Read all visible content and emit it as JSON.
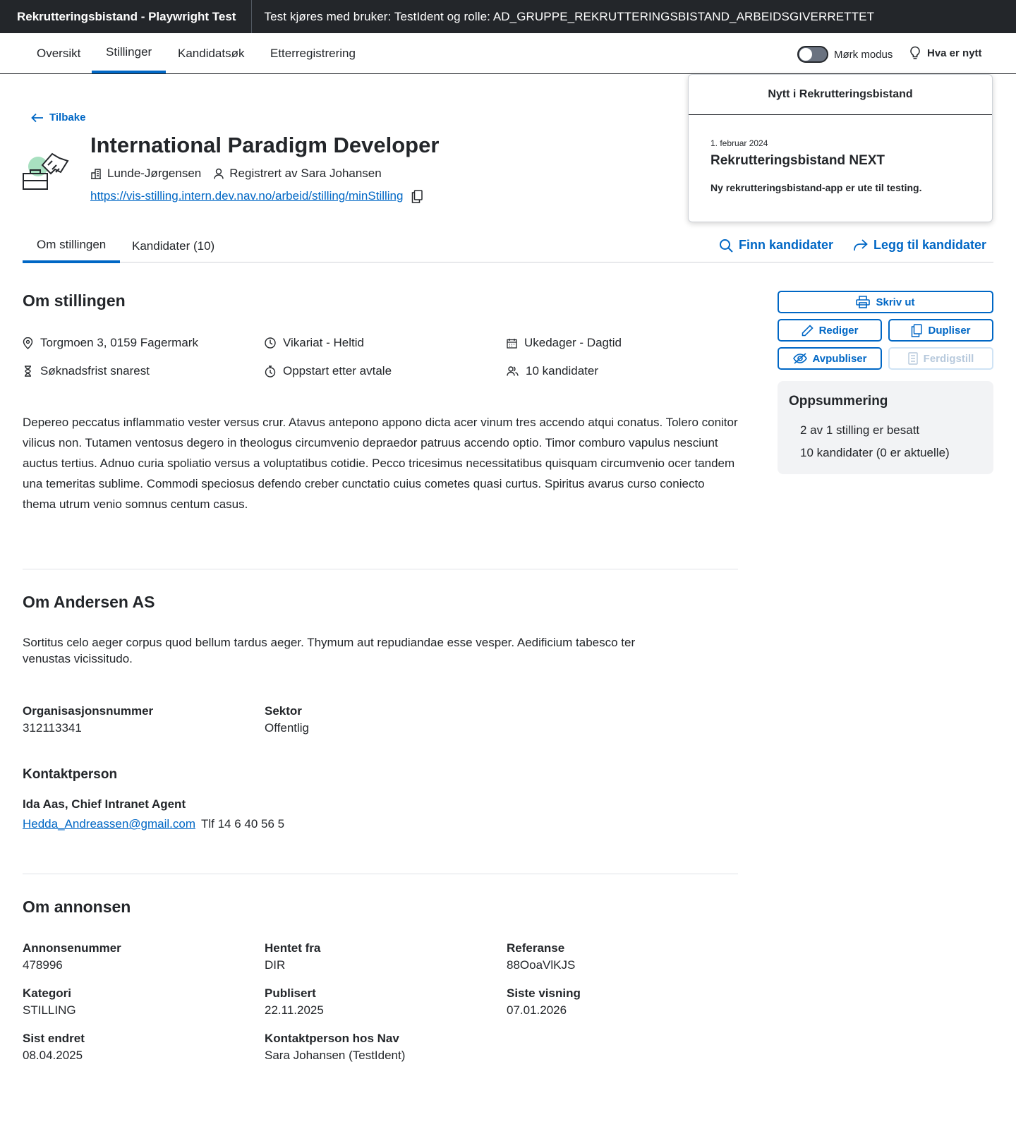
{
  "topbar": {
    "app_title": "Rekrutteringsbistand - Playwright Test",
    "test_info": "Test kjøres med bruker: TestIdent og rolle: AD_GRUPPE_REKRUTTERINGSBISTAND_ARBEIDSGIVERRETTET"
  },
  "nav": {
    "tabs": [
      "Oversikt",
      "Stillinger",
      "Kandidatsøk",
      "Etterregistrering"
    ],
    "active_tab": "Stillinger",
    "dark_mode_label": "Mørk modus",
    "news_label": "Hva er nytt"
  },
  "popover": {
    "header": "Nytt i Rekrutteringsbistand",
    "date": "1. februar 2024",
    "title": "Rekrutteringsbistand NEXT",
    "text": "Ny rekrutteringsbistand-app er ute til testing."
  },
  "header": {
    "back_label": "Tilbake",
    "job_title": "International Paradigm Developer",
    "employer": "Lunde-Jørgensen",
    "registered_by": "Registrert av Sara Johansen",
    "url": "https://vis-stilling.intern.dev.nav.no/arbeid/stilling/minStilling"
  },
  "subtabs": {
    "tabs": [
      "Om stillingen",
      "Kandidater (10)"
    ],
    "active_tab": "Om stillingen",
    "find_candidates": "Finn kandidater",
    "add_candidates": "Legg til kandidater"
  },
  "about_position": {
    "heading": "Om stillingen",
    "facts": {
      "address": "Torgmoen 3, 0159 Fagermark",
      "employment": "Vikariat - Heltid",
      "schedule": "Ukedager - Dagtid",
      "deadline": "Søknadsfrist snarest",
      "start": "Oppstart etter avtale",
      "candidates": "10 kandidater"
    },
    "description": "Depereo peccatus inflammatio vester versus crur. Atavus antepono appono dicta acer vinum tres accendo atqui conatus. Tolero conitor vilicus non. Tutamen ventosus degero in theologus circumvenio depraedor patruus accendo optio. Timor comburo vapulus nesciunt auctus tertius. Adnuo curia spoliatio versus a voluptatibus cotidie. Pecco tricesimus necessitatibus quisquam circumvenio ocer tandem una temeritas sublime. Commodi speciosus defendo creber cunctatio cuius cometes quasi curtus. Spiritus avarus curso coniecto thema utrum venio somnus centum casus."
  },
  "about_employer": {
    "heading": "Om Andersen AS",
    "description": "Sortitus celo aeger corpus quod bellum tardus aeger. Thymum aut repudiandae esse vesper. Aedificium tabesco ter venustas vicissitudo.",
    "org_number_label": "Organisasjonsnummer",
    "org_number": "312113341",
    "sector_label": "Sektor",
    "sector": "Offentlig",
    "contact_heading": "Kontaktperson",
    "contact_name": "Ida Aas, Chief Intranet Agent",
    "contact_email": "Hedda_Andreassen@gmail.com",
    "contact_phone": "Tlf 14 6 40 56 5"
  },
  "about_ad": {
    "heading": "Om annonsen",
    "fields": [
      {
        "label": "Annonsenummer",
        "value": "478996"
      },
      {
        "label": "Hentet fra",
        "value": "DIR"
      },
      {
        "label": "Referanse",
        "value": "88OoaVlKJS"
      },
      {
        "label": "Kategori",
        "value": "STILLING"
      },
      {
        "label": "Publisert",
        "value": "22.11.2025"
      },
      {
        "label": "Siste visning",
        "value": "07.01.2026"
      },
      {
        "label": "Sist endret",
        "value": "08.04.2025"
      },
      {
        "label": "Kontaktperson hos Nav",
        "value": "Sara Johansen (TestIdent)"
      }
    ]
  },
  "actions": {
    "print": "Skriv ut",
    "edit": "Rediger",
    "duplicate": "Dupliser",
    "unpublish": "Avpubliser",
    "complete": "Ferdigstill"
  },
  "summary": {
    "title": "Oppsummering",
    "line1": "2 av 1 stilling er besatt",
    "line2": "10 kandidater (0 er aktuelle)"
  },
  "colors": {
    "topbar_bg": "#23262a",
    "accent": "#0067c5",
    "summary_bg": "#f2f3f5"
  }
}
